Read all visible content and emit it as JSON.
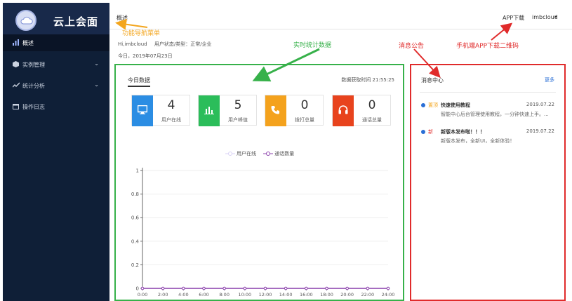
{
  "app": {
    "brand_name": "云上会面",
    "logo_icon": "cloud-icon"
  },
  "sidebar": {
    "items": [
      {
        "label": "概述",
        "icon": "chart-bar-icon",
        "active": true
      },
      {
        "label": "实例管理",
        "icon": "cube-icon",
        "chevron": "⌄"
      },
      {
        "label": "统计分析",
        "icon": "trend-line-icon",
        "chevron": "⌄"
      },
      {
        "label": "操作日志",
        "icon": "calendar-icon"
      }
    ]
  },
  "topbar": {
    "tab": "概述",
    "app_download": "APP下载",
    "user": "imbcloud",
    "user_arrow": "▾"
  },
  "welcome": {
    "greeting": "Hi,imbcloud",
    "status": "用户状态/类型：正常/企业",
    "date": "今日，2019年07月23日"
  },
  "stats": {
    "title": "今日数据",
    "fetch_time": "数据获取时间 21:55:25",
    "cards": [
      {
        "value": "4",
        "label": "用户在线",
        "color": "#2b8de3",
        "icon": "monitor-icon"
      },
      {
        "value": "5",
        "label": "用户峰值",
        "color": "#2bbd5a",
        "icon": "bar-chart-icon"
      },
      {
        "value": "0",
        "label": "拨打总量",
        "color": "#f4a21d",
        "icon": "phone-icon"
      },
      {
        "value": "0",
        "label": "通话总量",
        "color": "#e8431d",
        "icon": "headset-icon"
      }
    ],
    "legend": [
      "用户在线",
      "通话数量"
    ]
  },
  "chart_data": {
    "type": "line",
    "x": [
      "0:00",
      "2:00",
      "4:00",
      "6:00",
      "8:00",
      "10:00",
      "12:00",
      "14:00",
      "16:00",
      "18:00",
      "20:00",
      "22:00",
      "24:00"
    ],
    "series": [
      {
        "name": "用户在线",
        "color": "#d9d2f5",
        "values": [
          0,
          0,
          0,
          0,
          0,
          0,
          0,
          0,
          0,
          0,
          0,
          0,
          0
        ]
      },
      {
        "name": "通话数量",
        "color": "#8e44ad",
        "values": [
          0,
          0,
          0,
          0,
          0,
          0,
          0,
          0,
          0,
          0,
          0,
          0,
          0
        ]
      }
    ],
    "yticks": [
      0,
      0.2,
      0.4,
      0.6,
      0.8,
      1
    ],
    "ylim": [
      0,
      1
    ]
  },
  "messages": {
    "title": "消息中心",
    "more": "更多",
    "items": [
      {
        "tag": "置顶",
        "tag_color": "#f3a51d",
        "title": "快速使用教程",
        "date": "2019.07.22",
        "summary": "智能中心后台管理使用教程，一分钟快速上手。..."
      },
      {
        "tag": "新",
        "tag_color": "#e02b2b",
        "title": "新版本发布啦！！！",
        "date": "2019.07.22",
        "summary": "新版本发布，全新UI，全新体验！"
      }
    ]
  },
  "annotations": {
    "nav_menu": "功能导航菜单",
    "realtime": "实时统计数据",
    "announce": "消息公告",
    "qrcode": "手机端APP下载二维码",
    "colors": {
      "orange": "#f3a51d",
      "green": "#37b14a",
      "red": "#e02b2b"
    }
  }
}
